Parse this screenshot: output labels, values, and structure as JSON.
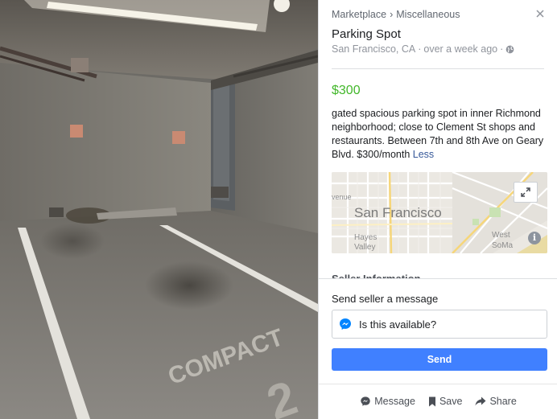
{
  "breadcrumb": {
    "category": "Marketplace",
    "subcategory": "Miscellaneous",
    "separator": "›"
  },
  "listing": {
    "title": "Parking Spot",
    "location": "San Francisco, CA",
    "posted": "over a week ago",
    "dot": "·",
    "price": "$300",
    "description": "gated spacious parking spot in inner Richmond neighborhood; close to Clement St shops and restaurants. Between 7th and 8th Ave on Geary Blvd. $300/month",
    "less_link": "Less"
  },
  "map": {
    "city_label": "San Francisco",
    "neighborhoods": [
      "venue",
      "Hayes",
      "Valley",
      "West",
      "SoMa"
    ],
    "info_glyph": "i"
  },
  "seller": {
    "section_title": "Seller Information"
  },
  "message": {
    "label": "Send seller a message",
    "input_value": "Is this available?",
    "send_label": "Send"
  },
  "actions": {
    "message": "Message",
    "save": "Save",
    "share": "Share"
  },
  "photo": {
    "floor_text": "COMPACT"
  },
  "icons": {
    "close": "close-icon",
    "globe": "globe-icon",
    "expand": "expand-icon",
    "messenger": "messenger-icon",
    "bookmark": "bookmark-icon",
    "share": "share-arrow-icon"
  },
  "colors": {
    "price": "#42b72a",
    "link": "#365899",
    "send_button": "#4080ff",
    "messenger": "#0084ff"
  }
}
